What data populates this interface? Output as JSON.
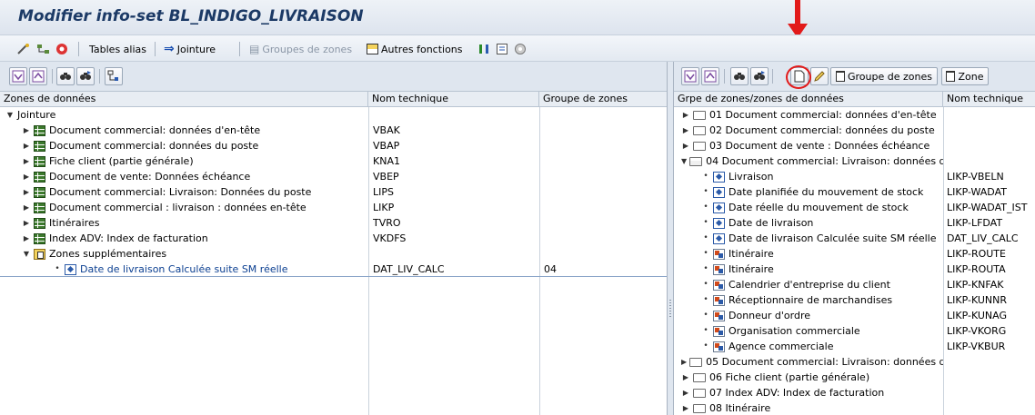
{
  "window": {
    "title": "Modifier info-set BL_INDIGO_LIVRAISON"
  },
  "appbar": {
    "tables_alias": "Tables alias",
    "jointure": "Jointure",
    "groupes_de_zones": "Groupes de zones",
    "autres_fonctions": "Autres fonctions"
  },
  "left": {
    "headers": {
      "zones": "Zones de données",
      "nom": "Nom technique",
      "groupe": "Groupe de zones"
    },
    "root": "Jointure",
    "tables": [
      {
        "label": "Document commercial: données d'en-tête",
        "tech": "VBAK"
      },
      {
        "label": "Document commercial: données du poste",
        "tech": "VBAP"
      },
      {
        "label": "Fiche client (partie générale)",
        "tech": "KNA1"
      },
      {
        "label": "Document de vente: Données échéance",
        "tech": "VBEP"
      },
      {
        "label": "Document commercial: Livraison: Données du poste",
        "tech": "LIPS"
      },
      {
        "label": "Document commercial : livraison : données en-tête",
        "tech": "LIKP"
      },
      {
        "label": "Itinéraires",
        "tech": "TVRO"
      },
      {
        "label": "Index ADV: Index de facturation",
        "tech": "VKDFS"
      }
    ],
    "extra_folder": "Zones supplémentaires",
    "extra_field": {
      "label": "Date de livraison Calculée suite SM réelle",
      "tech": "DAT_LIV_CALC",
      "group": "04"
    }
  },
  "right": {
    "buttons": {
      "groupe_de_zones": "Groupe de zones",
      "zone": "Zone"
    },
    "headers": {
      "grpe": "Grpe de zones/zones de données",
      "nom": "Nom technique"
    },
    "groups_before": [
      "01 Document commercial: données d'en-tête",
      "02 Document commercial: données du poste",
      "03 Document de vente : Données échéance"
    ],
    "open_group": "04 Document commercial: Livraison: données d",
    "fields": [
      {
        "label": "Livraison",
        "tech": "LIKP-VBELN",
        "icon": "field"
      },
      {
        "label": "Date planifiée du mouvement de stock",
        "tech": "LIKP-WADAT",
        "icon": "field"
      },
      {
        "label": "Date réelle du mouvement de stock",
        "tech": "LIKP-WADAT_IST",
        "icon": "field"
      },
      {
        "label": "Date de livraison",
        "tech": "LIKP-LFDAT",
        "icon": "field"
      },
      {
        "label": "Date de livraison Calculée suite SM réelle",
        "tech": "DAT_LIV_CALC",
        "icon": "field"
      },
      {
        "label": "Itinéraire",
        "tech": "LIKP-ROUTE",
        "icon": "link"
      },
      {
        "label": "Itinéraire",
        "tech": "LIKP-ROUTA",
        "icon": "link"
      },
      {
        "label": "Calendrier d'entreprise du client",
        "tech": "LIKP-KNFAK",
        "icon": "link"
      },
      {
        "label": "Réceptionnaire de marchandises",
        "tech": "LIKP-KUNNR",
        "icon": "link"
      },
      {
        "label": "Donneur d'ordre",
        "tech": "LIKP-KUNAG",
        "icon": "link"
      },
      {
        "label": "Organisation commerciale",
        "tech": "LIKP-VKORG",
        "icon": "link"
      },
      {
        "label": "Agence commerciale",
        "tech": "LIKP-VKBUR",
        "icon": "link"
      }
    ],
    "groups_after": [
      "05 Document commercial: Livraison: données d",
      "06 Fiche client (partie générale)",
      "07 Index ADV: Index de facturation",
      "08 Itinéraire"
    ]
  }
}
